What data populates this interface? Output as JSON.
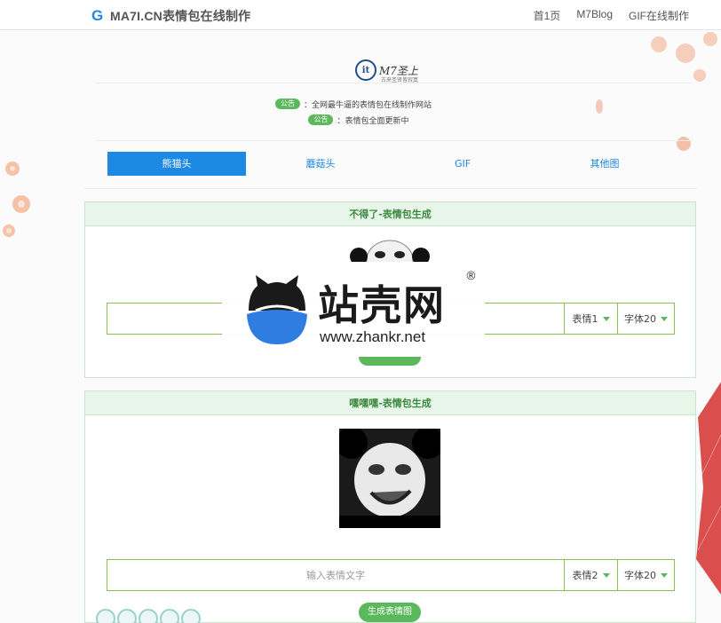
{
  "site": {
    "logo_letter": "G",
    "logo_text": "MA7I.CN表情包在线制作"
  },
  "nav": {
    "items": [
      "首1页",
      "M7Blog",
      "GIF在线制作"
    ]
  },
  "brand": {
    "mark": "it",
    "name": "M7圣上",
    "subtitle": "古来圣贤皆寂寞"
  },
  "notices": [
    {
      "badge": "公告",
      "text": "：全网最牛逼的表情包在线制作网站"
    },
    {
      "badge": "公告",
      "text": "：表情包全面更新中"
    }
  ],
  "tabs": [
    "熊猫头",
    "蘑菇头",
    "GIF",
    "其他图"
  ],
  "panels": [
    {
      "title": "不得了-表情包生成",
      "input_value": "",
      "input_placeholder": "",
      "face_select": "表情1",
      "font_select": "字体20",
      "button": ""
    },
    {
      "title": "嘿嘿嘿-表情包生成",
      "input_value": "",
      "input_placeholder": "输入表情文字",
      "face_select": "表情2",
      "font_select": "字体20",
      "button": "生成表情图"
    }
  ],
  "watermark": {
    "cn": "站壳网",
    "reg": "®",
    "url": "www.zhankr.net"
  },
  "colors": {
    "accent": "#1e88e5",
    "green": "#5cb85c",
    "panel_head_bg": "#e8f5e9"
  }
}
